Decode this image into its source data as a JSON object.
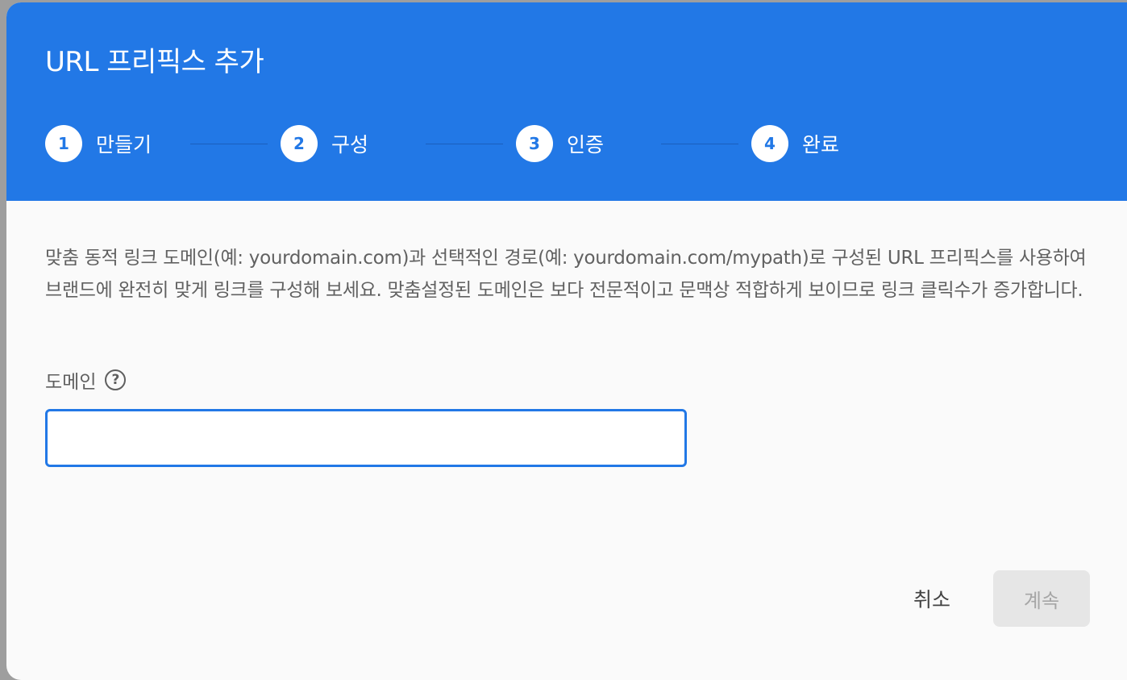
{
  "dialog": {
    "title": "URL 프리픽스 추가"
  },
  "stepper": {
    "steps": [
      {
        "number": "1",
        "label": "만들기"
      },
      {
        "number": "2",
        "label": "구성"
      },
      {
        "number": "3",
        "label": "인증"
      },
      {
        "number": "4",
        "label": "완료"
      }
    ],
    "active_step": 1
  },
  "body": {
    "description": "맞춤 동적 링크 도메인(예: yourdomain.com)과 선택적인 경로(예: yourdomain.com/mypath)로 구성된 URL 프리픽스를 사용하여 브랜드에 완전히 맞게 링크를 구성해 보세요. 맞춤설정된 도메인은 보다 전문적이고 문맥상 적합하게 보이므로 링크 클릭수가 증가합니다.",
    "domain_field": {
      "label": "도메인",
      "help_icon": "help-circle-icon",
      "value": "",
      "placeholder": ""
    }
  },
  "actions": {
    "cancel_label": "취소",
    "continue_label": "계속"
  },
  "colors": {
    "header_bg": "#2278e6",
    "accent": "#2278e6",
    "disabled_bg": "#e6e6e6",
    "disabled_text": "#a6a6a6"
  }
}
